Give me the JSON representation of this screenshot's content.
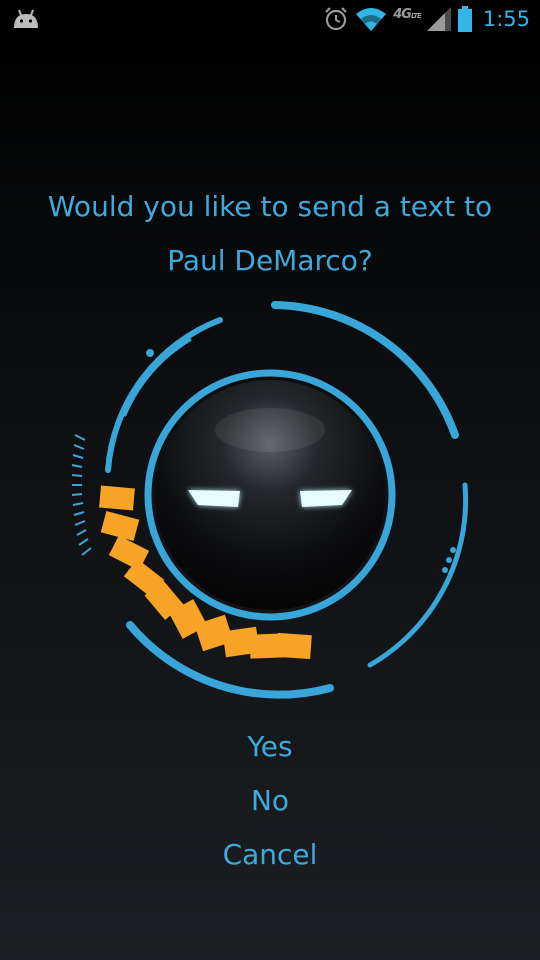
{
  "status_bar": {
    "network": "4G",
    "network_sub": "LTE",
    "time": "1:55",
    "icons": [
      "android-icon",
      "alarm-icon",
      "wifi-icon",
      "signal-icon",
      "battery-icon"
    ],
    "battery_level": 0.9,
    "signal_level": 0.75
  },
  "prompt": {
    "line1": "Would you like to send a text to",
    "line2": "Paul DeMarco?"
  },
  "voice_assistant": {
    "icon": "iron-man-helmet-icon",
    "level_bars_total": 9,
    "level_bars_lit": 9
  },
  "options": [
    {
      "label": "Yes"
    },
    {
      "label": "No"
    },
    {
      "label": "Cancel"
    }
  ],
  "colors": {
    "accent": "#3fa9dc",
    "ring": "#38a6d8",
    "level": "#f7a325",
    "eyes": "#e8fbff",
    "clock": "#33b5e5"
  }
}
